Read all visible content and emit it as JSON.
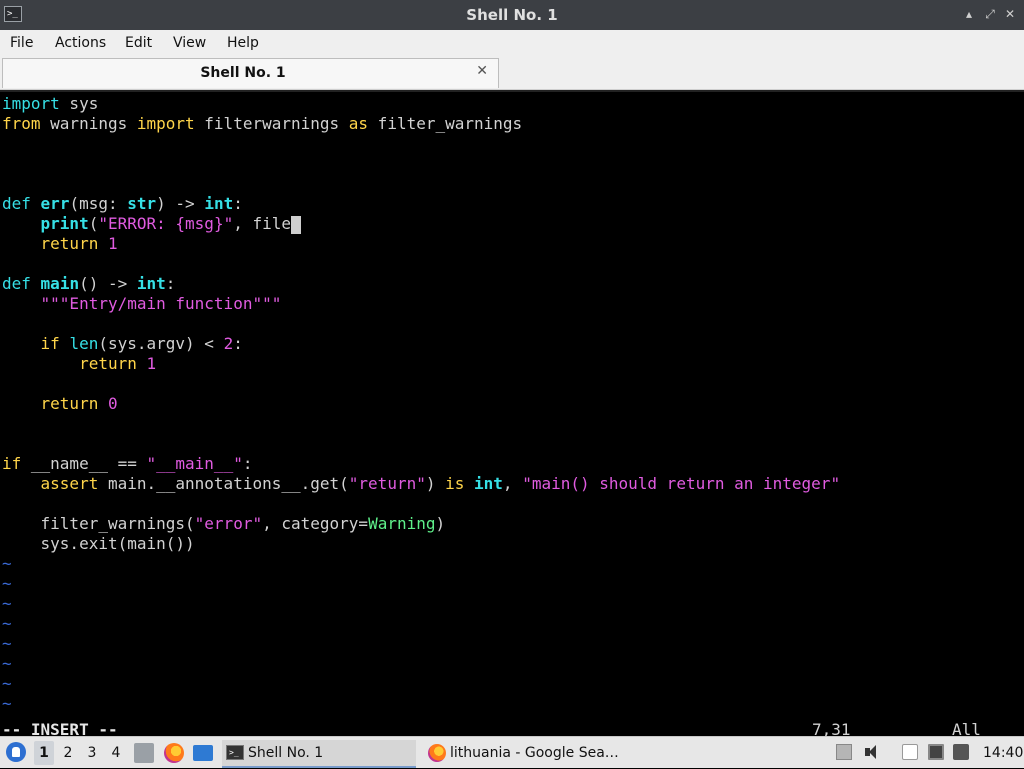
{
  "window": {
    "title": "Shell No. 1"
  },
  "menu": [
    "File",
    "Actions",
    "Edit",
    "View",
    "Help"
  ],
  "tab": {
    "label": "Shell No. 1"
  },
  "editor": {
    "lines": [
      [
        {
          "t": "import",
          "c": "kw"
        },
        {
          "t": " sys",
          "c": "txt"
        }
      ],
      [
        {
          "t": "from",
          "c": "op"
        },
        {
          "t": " warnings ",
          "c": "txt"
        },
        {
          "t": "import",
          "c": "op"
        },
        {
          "t": " filterwarnings ",
          "c": "txt"
        },
        {
          "t": "as",
          "c": "op"
        },
        {
          "t": " filter_warnings",
          "c": "txt"
        }
      ],
      [],
      [],
      [],
      [
        {
          "t": "def",
          "c": "kw"
        },
        {
          "t": " ",
          "c": "txt"
        },
        {
          "t": "err",
          "c": "fn"
        },
        {
          "t": "(msg: ",
          "c": "txt"
        },
        {
          "t": "str",
          "c": "bi"
        },
        {
          "t": ") -> ",
          "c": "txt"
        },
        {
          "t": "int",
          "c": "bi"
        },
        {
          "t": ":",
          "c": "txt"
        }
      ],
      [
        {
          "t": "    ",
          "c": "txt"
        },
        {
          "t": "print",
          "c": "bi"
        },
        {
          "t": "(",
          "c": "txt"
        },
        {
          "t": "\"ERROR: {msg}\"",
          "c": "str"
        },
        {
          "t": ", file",
          "c": "txt"
        },
        {
          "cursor": true
        }
      ],
      [
        {
          "t": "    ",
          "c": "txt"
        },
        {
          "t": "return",
          "c": "op"
        },
        {
          "t": " ",
          "c": "txt"
        },
        {
          "t": "1",
          "c": "num"
        }
      ],
      [],
      [
        {
          "t": "def",
          "c": "kw"
        },
        {
          "t": " ",
          "c": "txt"
        },
        {
          "t": "main",
          "c": "fn"
        },
        {
          "t": "() -> ",
          "c": "txt"
        },
        {
          "t": "int",
          "c": "bi"
        },
        {
          "t": ":",
          "c": "txt"
        }
      ],
      [
        {
          "t": "    ",
          "c": "txt"
        },
        {
          "t": "\"\"\"Entry/main function\"\"\"",
          "c": "str"
        }
      ],
      [],
      [
        {
          "t": "    ",
          "c": "txt"
        },
        {
          "t": "if",
          "c": "op"
        },
        {
          "t": " ",
          "c": "txt"
        },
        {
          "t": "len",
          "c": "kw"
        },
        {
          "t": "(sys.argv) < ",
          "c": "txt"
        },
        {
          "t": "2",
          "c": "num"
        },
        {
          "t": ":",
          "c": "txt"
        }
      ],
      [
        {
          "t": "        ",
          "c": "txt"
        },
        {
          "t": "return",
          "c": "op"
        },
        {
          "t": " ",
          "c": "txt"
        },
        {
          "t": "1",
          "c": "num"
        }
      ],
      [],
      [
        {
          "t": "    ",
          "c": "txt"
        },
        {
          "t": "return",
          "c": "op"
        },
        {
          "t": " ",
          "c": "txt"
        },
        {
          "t": "0",
          "c": "num"
        }
      ],
      [],
      [],
      [
        {
          "t": "if",
          "c": "op"
        },
        {
          "t": " __name__ == ",
          "c": "txt"
        },
        {
          "t": "\"__main__\"",
          "c": "str"
        },
        {
          "t": ":",
          "c": "txt"
        }
      ],
      [
        {
          "t": "    ",
          "c": "txt"
        },
        {
          "t": "assert",
          "c": "op"
        },
        {
          "t": " main.__annotations__.get(",
          "c": "txt"
        },
        {
          "t": "\"return\"",
          "c": "str"
        },
        {
          "t": ") ",
          "c": "txt"
        },
        {
          "t": "is",
          "c": "op"
        },
        {
          "t": " ",
          "c": "txt"
        },
        {
          "t": "int",
          "c": "bi"
        },
        {
          "t": ", ",
          "c": "txt"
        },
        {
          "t": "\"main() should return an integer\"",
          "c": "str"
        }
      ],
      [],
      [
        {
          "t": "    filter_warnings(",
          "c": "txt"
        },
        {
          "t": "\"error\"",
          "c": "str"
        },
        {
          "t": ", category=",
          "c": "txt"
        },
        {
          "t": "Warning",
          "c": "cls"
        },
        {
          "t": ")",
          "c": "txt"
        }
      ],
      [
        {
          "t": "    sys.exit(main())",
          "c": "txt"
        }
      ],
      [
        {
          "t": "~",
          "c": "tilde"
        }
      ],
      [
        {
          "t": "~",
          "c": "tilde"
        }
      ],
      [
        {
          "t": "~",
          "c": "tilde"
        }
      ],
      [
        {
          "t": "~",
          "c": "tilde"
        }
      ],
      [
        {
          "t": "~",
          "c": "tilde"
        }
      ],
      [
        {
          "t": "~",
          "c": "tilde"
        }
      ],
      [
        {
          "t": "~",
          "c": "tilde"
        }
      ],
      [
        {
          "t": "~",
          "c": "tilde"
        }
      ]
    ],
    "status_mode": "-- INSERT --",
    "status_position": "7,31",
    "status_scroll": "All"
  },
  "taskbar": {
    "workspaces": [
      "1",
      "2",
      "3",
      "4"
    ],
    "active_workspace": "1",
    "tasks": [
      {
        "label": "Shell No. 1",
        "icon": "terminal-icon",
        "active": true
      },
      {
        "label": "lithuania - Google Sea…",
        "icon": "firefox-icon",
        "active": false
      }
    ],
    "clock": "14:40"
  }
}
